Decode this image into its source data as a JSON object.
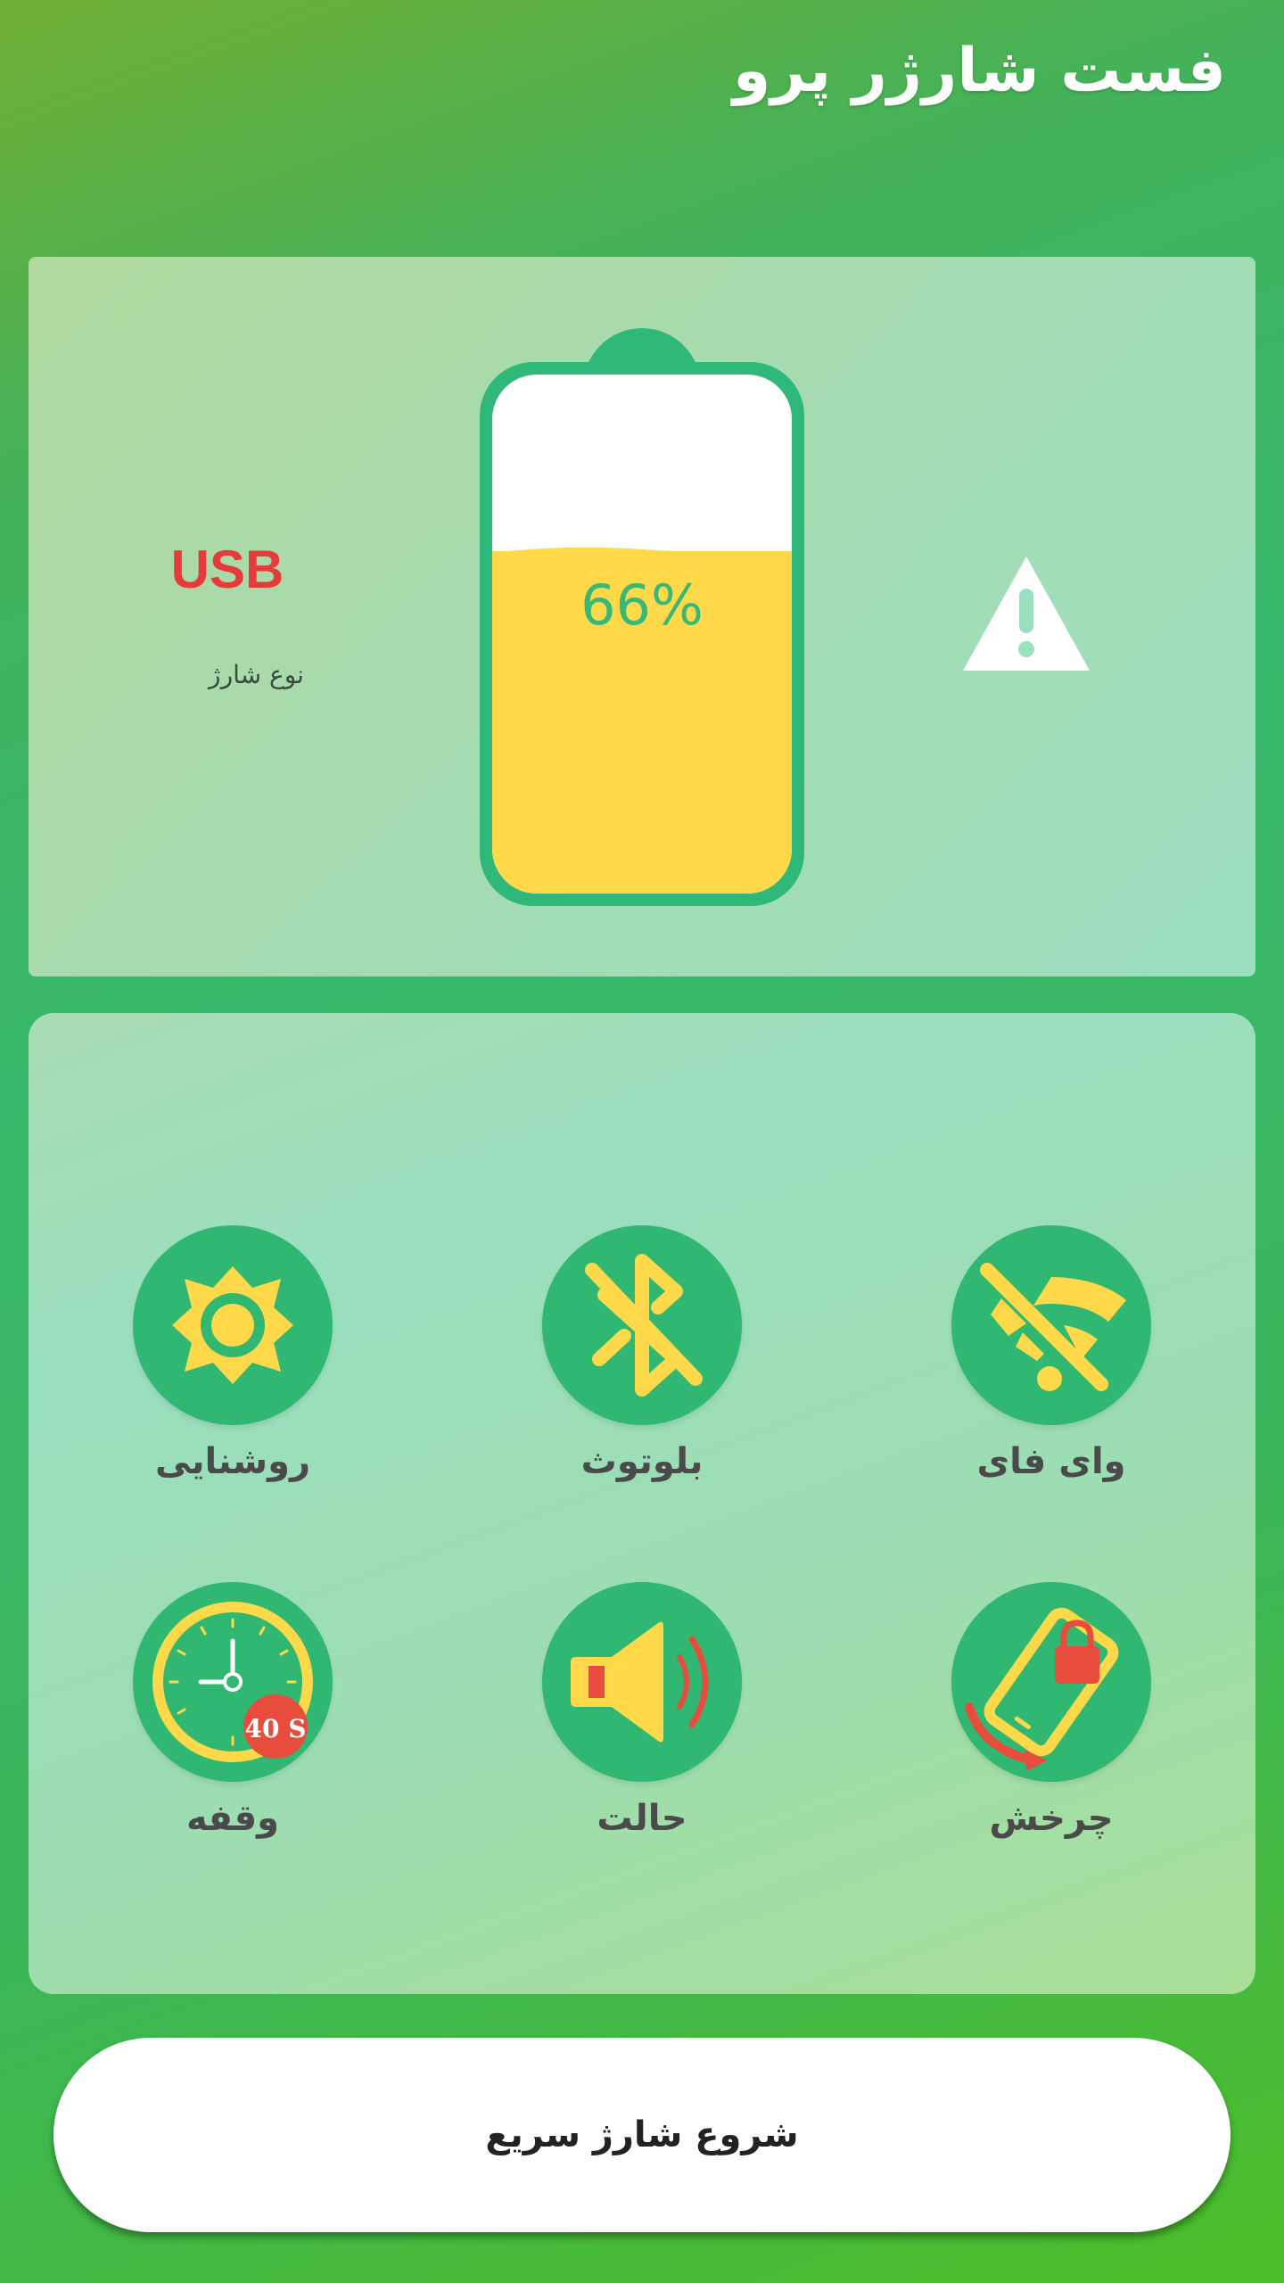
{
  "app": {
    "title": "فست شارژر پرو"
  },
  "battery": {
    "charge_type_value": "USB",
    "charge_type_label": "نوع شارژ",
    "percent_text": "66%",
    "level": 0.66,
    "status_icon": "warning-icon"
  },
  "controls": [
    {
      "id": "brightness",
      "label": "روشنایی",
      "icon": "brightness-icon"
    },
    {
      "id": "bluetooth",
      "label": "بلوتوث",
      "icon": "bluetooth-off-icon"
    },
    {
      "id": "wifi",
      "label": "وای فای",
      "icon": "wifi-off-icon"
    },
    {
      "id": "timeout",
      "label": "وقفه",
      "icon": "clock-icon",
      "badge": "40 S"
    },
    {
      "id": "sound",
      "label": "حالت",
      "icon": "speaker-icon"
    },
    {
      "id": "rotation",
      "label": "چرخش",
      "icon": "rotation-lock-icon"
    }
  ],
  "start_button": {
    "label": "شروع شارژ سریع"
  },
  "colors": {
    "accent_green": "#30b873",
    "icon_yellow": "#ffd94a",
    "usb_red": "#e53b3b",
    "badge_red": "#e74c3c"
  }
}
